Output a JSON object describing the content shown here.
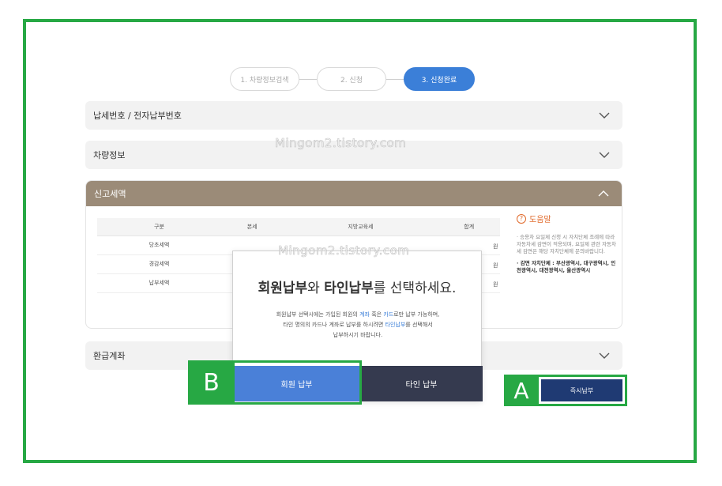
{
  "steps": [
    "1. 차량정보검색",
    "2. 신청",
    "3. 신청완료"
  ],
  "sections": {
    "tax_number": "납세번호 / 전자납부번호",
    "vehicle_info": "차량정보",
    "reported_tax": "신고세액",
    "refund_account": "환급계좌"
  },
  "tax_table": {
    "headers": [
      "구분",
      "본세",
      "지방교육세",
      "합계"
    ],
    "rows": [
      "당초세액",
      "경감세액",
      "납부세액"
    ],
    "unit": "원"
  },
  "help": {
    "title": "도움말",
    "text": "· 승용차 요일제 신청 시 자치단체 조례에 따라 자동차세 감면이 적용되며, 요일제 관련 자동차세 감면은 해당 자치단체에 문의바랍니다.",
    "bold": "· 감면 자치단체 : 부산광역시, 대구광역시, 인천광역시, 대전광역시, 울산광역시"
  },
  "modal": {
    "title_part1": "회원납부",
    "title_part2": "와 ",
    "title_part3": "타인납부",
    "title_part4": "를 선택하세요.",
    "desc_line1_a": "회원납부 선택시에는 가입된 회원의 ",
    "desc_line1_blue1": "계좌",
    "desc_line1_b": " 혹은 ",
    "desc_line1_blue2": "카드",
    "desc_line1_c": "로만 납부 가능하며,",
    "desc_line2_a": "타인 명의의 카드나 계좌로 납부를 하시려면 ",
    "desc_line2_blue": "타인납부",
    "desc_line2_b": "를 선택해서",
    "desc_line3": "납부하시기 바랍니다.",
    "member_button": "회원 납부",
    "other_button": "타인 납부"
  },
  "pay_now_button": "즉시납부",
  "annotations": {
    "a": "A",
    "b": "B"
  },
  "watermark": "Mingom2.tistory.com",
  "colors": {
    "highlight": "#27a844",
    "accent": "#3b7fd8",
    "panel_header": "#9b8b78",
    "pay_button": "#1f3a73"
  }
}
